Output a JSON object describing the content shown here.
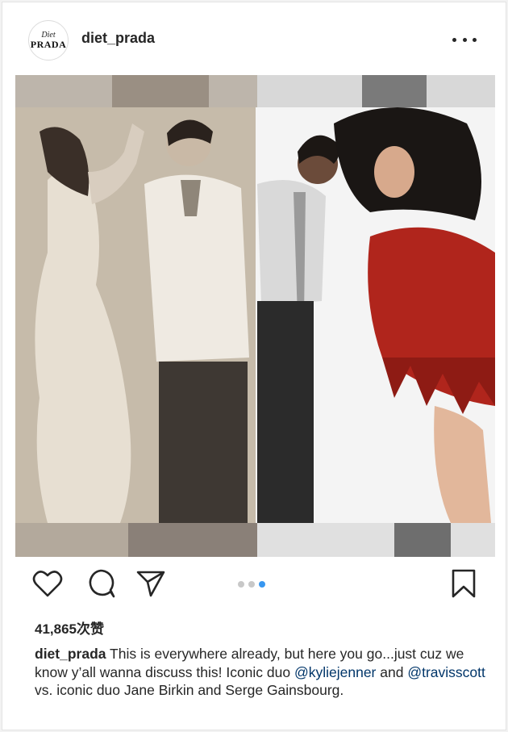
{
  "header": {
    "avatar_small": "Diet",
    "avatar_big": "PRADA",
    "username": "diet_prada",
    "more_icon": "more-horizontal-icon"
  },
  "actions": {
    "like_icon": "heart-icon",
    "comment_icon": "comment-icon",
    "share_icon": "send-icon",
    "save_icon": "bookmark-icon",
    "carousel": {
      "count": 3,
      "active_index": 2,
      "active_color": "#3897f0",
      "inactive_color": "#c8c8c8"
    }
  },
  "post": {
    "likes": "41,865次赞",
    "caption_user": "diet_prada",
    "caption_part1": " This is everywhere already, but here you go...just cuz we know y’all wanna discuss this!  Iconic duo ",
    "mention1": "@kyliejenner",
    "caption_part2": " and ",
    "mention2": "@travisscott",
    "caption_part3": " vs. iconic duo Jane Birkin and Serge Gainsbourg."
  },
  "colors": {
    "text": "#262626",
    "mention": "#003569",
    "fringe_dress": "#b0251c"
  }
}
